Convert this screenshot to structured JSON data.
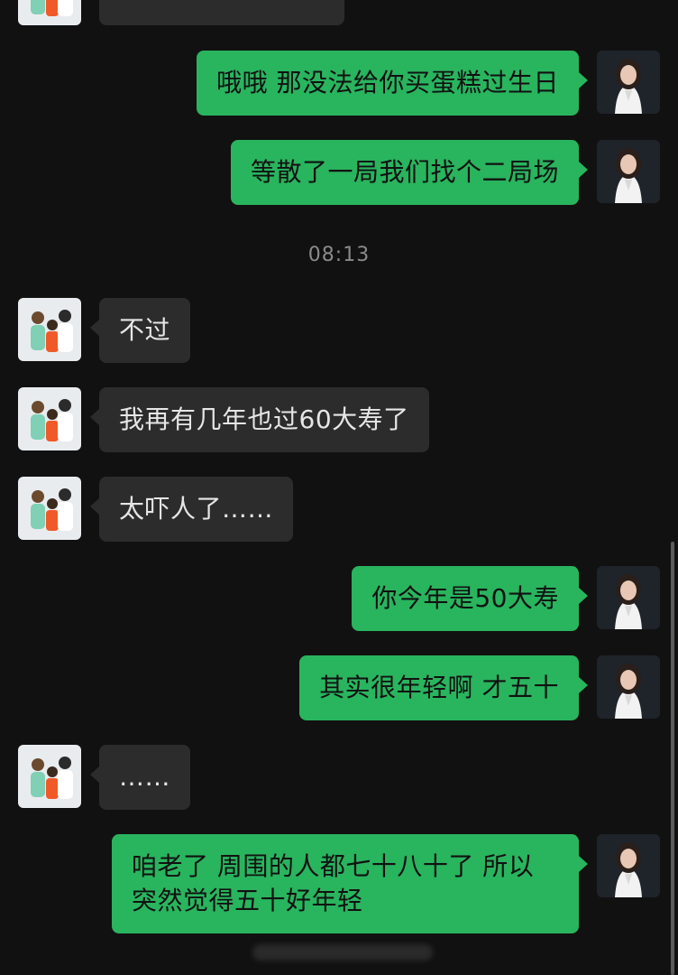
{
  "chat": {
    "timestamp": "08:13",
    "messages": [
      {
        "from": "partner",
        "text": ""
      },
      {
        "from": "me",
        "text": "哦哦 那没法给你买蛋糕过生日"
      },
      {
        "from": "me",
        "text": "等散了一局我们找个二局场"
      },
      {
        "from": "partner",
        "text": "不过"
      },
      {
        "from": "partner",
        "text": "我再有几年也过60大寿了"
      },
      {
        "from": "partner",
        "text": "太吓人了……"
      },
      {
        "from": "me",
        "text": "你今年是50大寿"
      },
      {
        "from": "me",
        "text": "其实很年轻啊 才五十"
      },
      {
        "from": "partner",
        "text": "……"
      },
      {
        "from": "me",
        "text": "咱老了 周围的人都七十八十了 所以突然觉得五十好年轻"
      }
    ]
  },
  "colors": {
    "background": "#111111",
    "incoming_bubble": "#2c2c2c",
    "outgoing_bubble": "#29b45e"
  },
  "icons": {
    "partner_avatar": "family-photo-avatar",
    "my_avatar": "woman-portrait-avatar"
  }
}
